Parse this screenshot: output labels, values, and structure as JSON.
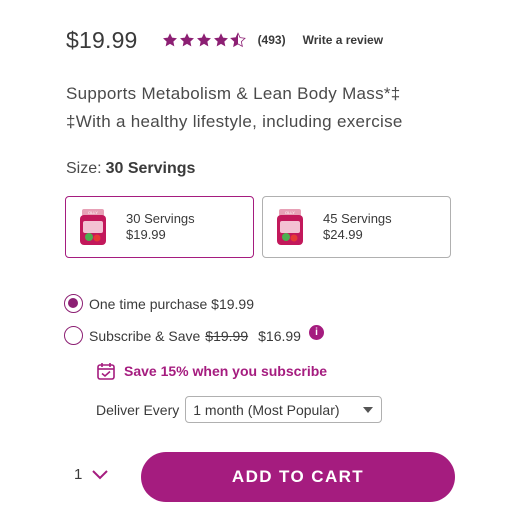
{
  "product": {
    "price": "$19.99",
    "rating": 4.5,
    "review_count": "(493)",
    "write_review_label": "Write a review",
    "headline_line1": "Supports Metabolism & Lean Body Mass*‡",
    "headline_line2": "‡With a healthy lifestyle, including exercise"
  },
  "size": {
    "label": "Size:",
    "selected": "30 Servings",
    "options": [
      {
        "name": "30 Servings",
        "price": "$19.99",
        "selected": true
      },
      {
        "name": "45 Servings",
        "price": "$24.99",
        "selected": false
      }
    ]
  },
  "purchase": {
    "one_time_label": "One time purchase $19.99",
    "subscribe_label": "Subscribe & Save",
    "subscribe_original_price": "$19.99",
    "subscribe_price": "$16.99",
    "info_icon": "i",
    "save_text": "Save 15% when you subscribe",
    "deliver_label": "Deliver Every",
    "deliver_selected": "1 month (Most Popular)"
  },
  "cart": {
    "quantity": "1",
    "add_to_cart_label": "ADD TO CART"
  },
  "colors": {
    "accent": "#a51c7f",
    "star": "#8c1f73",
    "text": "#3a3a3a"
  },
  "icons": {
    "star": "star-icon",
    "info": "info-icon",
    "calendar": "calendar-icon",
    "caret": "caret-down-icon",
    "chevron": "chevron-down-icon"
  }
}
